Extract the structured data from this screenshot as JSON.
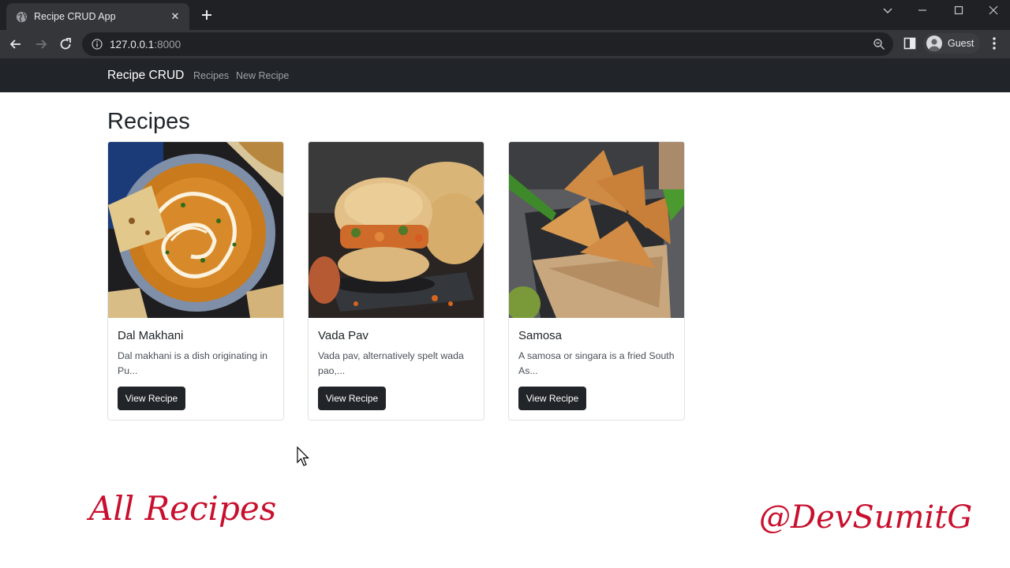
{
  "browser": {
    "tab_title": "Recipe CRUD App",
    "url_host": "127.0.0.1",
    "url_port": ":8000",
    "profile_label": "Guest"
  },
  "navbar": {
    "brand": "Recipe CRUD",
    "links": [
      "Recipes",
      "New Recipe"
    ]
  },
  "page": {
    "title": "Recipes"
  },
  "recipes": [
    {
      "title": "Dal Makhani",
      "description": "Dal makhani is a dish originating in Pu...",
      "button": "View Recipe"
    },
    {
      "title": "Vada Pav",
      "description": "Vada pav, alternatively spelt wada pao,...",
      "button": "View Recipe"
    },
    {
      "title": "Samosa",
      "description": "A samosa or singara is a fried South As...",
      "button": "View Recipe"
    }
  ],
  "overlay": {
    "caption_left": "All Recipes",
    "caption_right": "@DevSumitG"
  },
  "colors": {
    "browser_frame": "#202124",
    "navbar_bg": "#212529",
    "button_bg": "#212529",
    "caption": "#c8102e"
  }
}
